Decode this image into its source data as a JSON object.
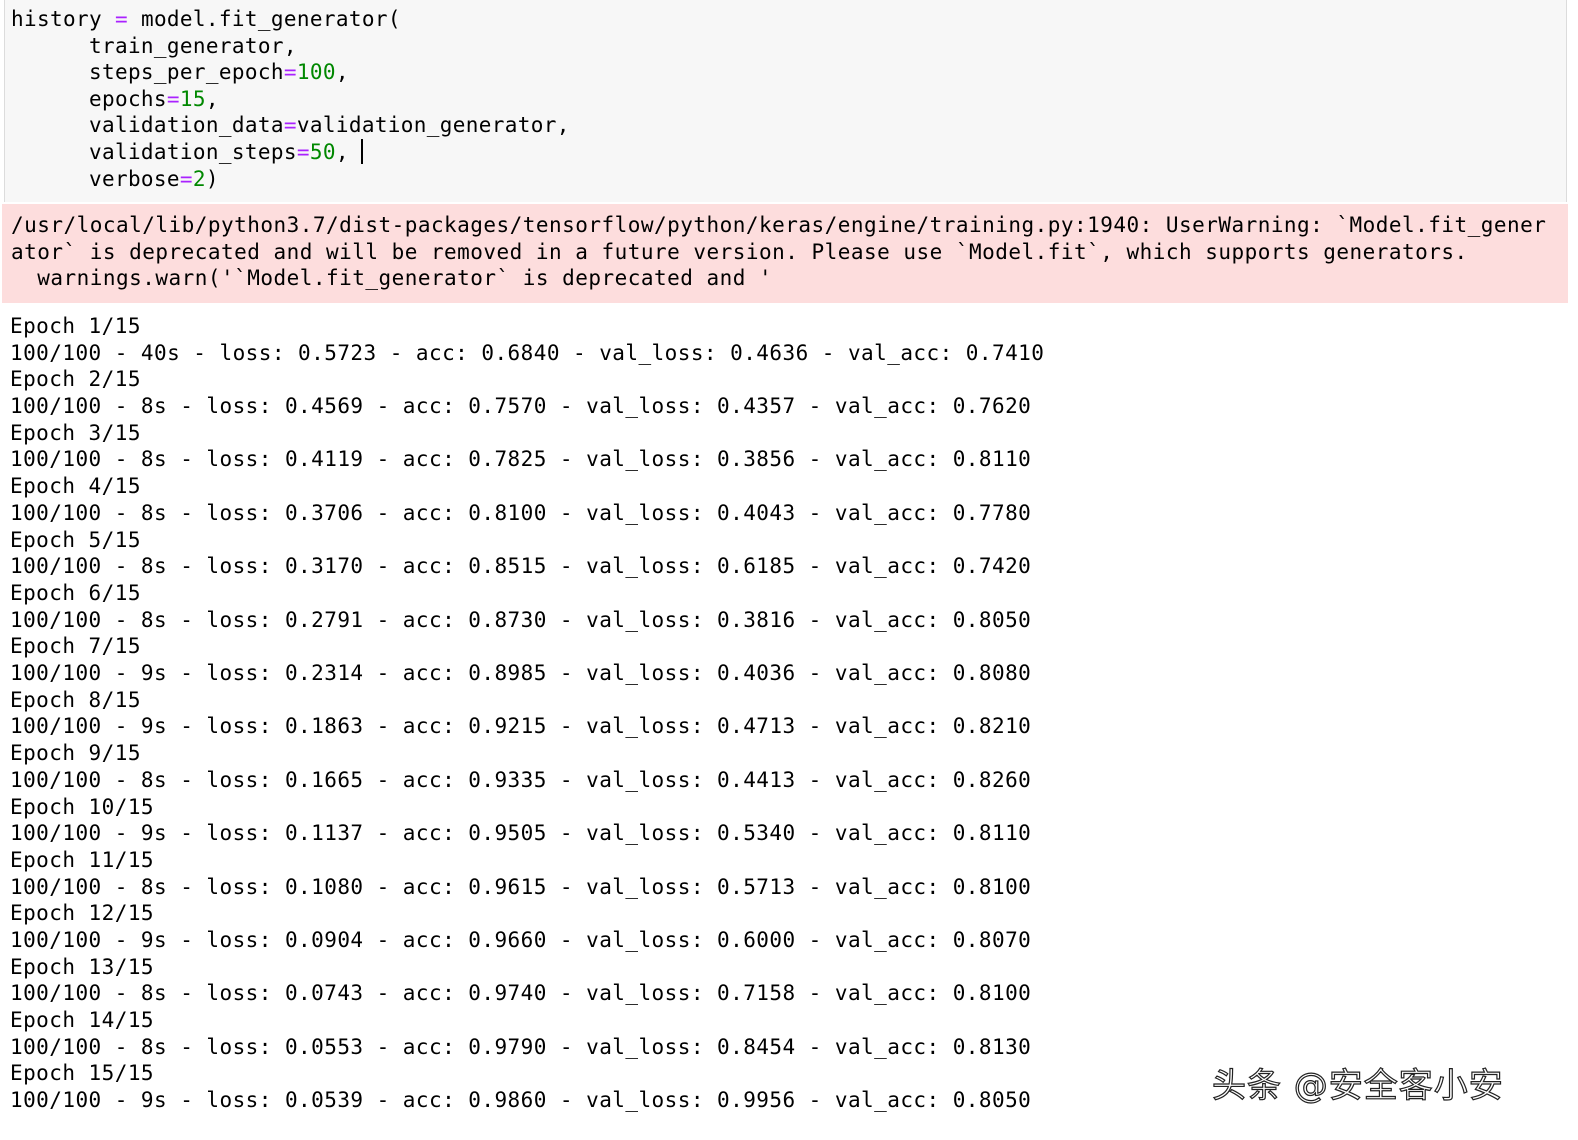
{
  "code_cell": {
    "lines": [
      {
        "a": "history ",
        "op": "=",
        "b": " model.fit_generator("
      },
      {
        "a": "      train_generator,"
      },
      {
        "a": "      steps_per_epoch",
        "op": "=",
        "num": "100",
        "b": ","
      },
      {
        "a": "      epochs",
        "op": "=",
        "num": "15",
        "b": ","
      },
      {
        "a": "      validation_data",
        "op": "=",
        "b": "validation_generator,"
      },
      {
        "a": "      validation_steps",
        "op": "=",
        "num": "50",
        "b": ","
      },
      {
        "a": "      verbose",
        "op": "=",
        "num": "2",
        "b": ")"
      }
    ]
  },
  "stderr": {
    "lines": [
      "/usr/local/lib/python3.7/dist-packages/tensorflow/python/keras/engine/training.py:1940: UserWarning: `Model.fit_gener",
      "ator` is deprecated and will be removed in a future version. Please use `Model.fit`, which supports generators.",
      "  warnings.warn('`Model.fit_generator` is deprecated and '"
    ]
  },
  "stdout": {
    "epochs": [
      {
        "header": "Epoch 1/15",
        "progress": "100/100 - 40s - loss: 0.5723 - acc: 0.6840 - val_loss: 0.4636 - val_acc: 0.7410"
      },
      {
        "header": "Epoch 2/15",
        "progress": "100/100 - 8s - loss: 0.4569 - acc: 0.7570 - val_loss: 0.4357 - val_acc: 0.7620"
      },
      {
        "header": "Epoch 3/15",
        "progress": "100/100 - 8s - loss: 0.4119 - acc: 0.7825 - val_loss: 0.3856 - val_acc: 0.8110"
      },
      {
        "header": "Epoch 4/15",
        "progress": "100/100 - 8s - loss: 0.3706 - acc: 0.8100 - val_loss: 0.4043 - val_acc: 0.7780"
      },
      {
        "header": "Epoch 5/15",
        "progress": "100/100 - 8s - loss: 0.3170 - acc: 0.8515 - val_loss: 0.6185 - val_acc: 0.7420"
      },
      {
        "header": "Epoch 6/15",
        "progress": "100/100 - 8s - loss: 0.2791 - acc: 0.8730 - val_loss: 0.3816 - val_acc: 0.8050"
      },
      {
        "header": "Epoch 7/15",
        "progress": "100/100 - 9s - loss: 0.2314 - acc: 0.8985 - val_loss: 0.4036 - val_acc: 0.8080"
      },
      {
        "header": "Epoch 8/15",
        "progress": "100/100 - 9s - loss: 0.1863 - acc: 0.9215 - val_loss: 0.4713 - val_acc: 0.8210"
      },
      {
        "header": "Epoch 9/15",
        "progress": "100/100 - 8s - loss: 0.1665 - acc: 0.9335 - val_loss: 0.4413 - val_acc: 0.8260"
      },
      {
        "header": "Epoch 10/15",
        "progress": "100/100 - 9s - loss: 0.1137 - acc: 0.9505 - val_loss: 0.5340 - val_acc: 0.8110"
      },
      {
        "header": "Epoch 11/15",
        "progress": "100/100 - 8s - loss: 0.1080 - acc: 0.9615 - val_loss: 0.5713 - val_acc: 0.8100"
      },
      {
        "header": "Epoch 12/15",
        "progress": "100/100 - 9s - loss: 0.0904 - acc: 0.9660 - val_loss: 0.6000 - val_acc: 0.8070"
      },
      {
        "header": "Epoch 13/15",
        "progress": "100/100 - 8s - loss: 0.0743 - acc: 0.9740 - val_loss: 0.7158 - val_acc: 0.8100"
      },
      {
        "header": "Epoch 14/15",
        "progress": "100/100 - 8s - loss: 0.0553 - acc: 0.9790 - val_loss: 0.8454 - val_acc: 0.8130"
      },
      {
        "header": "Epoch 15/15",
        "progress": "100/100 - 9s - loss: 0.0539 - acc: 0.9860 - val_loss: 0.9956 - val_acc: 0.8050"
      }
    ]
  },
  "watermark": {
    "text": "头条 @安全客小安"
  }
}
